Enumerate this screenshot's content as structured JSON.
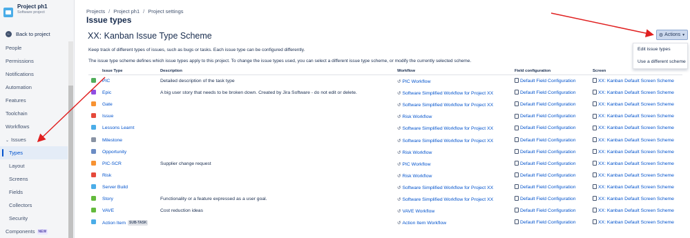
{
  "sidebar": {
    "project_name": "Project ph1",
    "project_type": "Software project",
    "back_label": "Back to project",
    "items": [
      {
        "label": "People"
      },
      {
        "label": "Permissions"
      },
      {
        "label": "Notifications"
      },
      {
        "label": "Automation"
      },
      {
        "label": "Features"
      },
      {
        "label": "Toolchain"
      },
      {
        "label": "Workflows"
      },
      {
        "label": "Issues"
      },
      {
        "label": "Types"
      },
      {
        "label": "Layout"
      },
      {
        "label": "Screens"
      },
      {
        "label": "Fields"
      },
      {
        "label": "Collectors"
      },
      {
        "label": "Security"
      },
      {
        "label": "Components",
        "badge": "NEW"
      }
    ]
  },
  "breadcrumb": [
    "Projects",
    "Project ph1",
    "Project settings"
  ],
  "page_title": "Issue types",
  "scheme_title": "XX: Kanban Issue Type Scheme",
  "description_1": "Keep track of different types of issues, such as bugs or tasks. Each issue type can be configured differently.",
  "description_2": "The issue type scheme defines which issue types apply to this project. To change the issue types used, you can select a different issue type scheme, or modify the currently selected scheme.",
  "actions": {
    "label": "Actions",
    "menu": [
      "Edit issue types",
      "Use a different scheme"
    ]
  },
  "table": {
    "headers": [
      "Issue Type",
      "Description",
      "Workflow",
      "Field configuration",
      "Screen"
    ],
    "rows": [
      {
        "name": "PIC",
        "icon_color": "#4fad5b",
        "description": "Detailed description of the task type",
        "workflow": "PIC Workflow",
        "field_config": "Default Field Configuration",
        "screen": "XX: Kanban Default Screen Scheme"
      },
      {
        "name": "Epic",
        "icon_color": "#904ee2",
        "description": "A big user story that needs to be broken down. Created by Jira Software - do not edit or delete.",
        "workflow": "Software Simplified Workflow for Project XX",
        "field_config": "Default Field Configuration",
        "screen": "XX: Kanban Default Screen Scheme"
      },
      {
        "name": "Gate",
        "icon_color": "#f79232",
        "description": "",
        "workflow": "Software Simplified Workflow for Project XX",
        "field_config": "Default Field Configuration",
        "screen": "XX: Kanban Default Screen Scheme"
      },
      {
        "name": "Issue",
        "icon_color": "#e5493a",
        "description": "",
        "workflow": "Risk Workflow",
        "field_config": "Default Field Configuration",
        "screen": "XX: Kanban Default Screen Scheme"
      },
      {
        "name": "Lessons Learnt",
        "icon_color": "#4bade8",
        "description": "",
        "workflow": "Software Simplified Workflow for Project XX",
        "field_config": "Default Field Configuration",
        "screen": "XX: Kanban Default Screen Scheme"
      },
      {
        "name": "Milestone",
        "icon_color": "#8993a4",
        "description": "",
        "workflow": "Software Simplified Workflow for Project XX",
        "field_config": "Default Field Configuration",
        "screen": "XX: Kanban Default Screen Scheme"
      },
      {
        "name": "Opportunity",
        "icon_color": "#6b8cc4",
        "description": "",
        "workflow": "Risk Workflow",
        "field_config": "Default Field Configuration",
        "screen": "XX: Kanban Default Screen Scheme"
      },
      {
        "name": "PIC-SCR",
        "icon_color": "#f79232",
        "description": "Supplier change request",
        "workflow": "PIC Workflow",
        "field_config": "Default Field Configuration",
        "screen": "XX: Kanban Default Screen Scheme"
      },
      {
        "name": "Risk",
        "icon_color": "#e5493a",
        "description": "",
        "workflow": "Risk Workflow",
        "field_config": "Default Field Configuration",
        "screen": "XX: Kanban Default Screen Scheme"
      },
      {
        "name": "Server Build",
        "icon_color": "#4bade8",
        "description": "",
        "workflow": "Software Simplified Workflow for Project XX",
        "field_config": "Default Field Configuration",
        "screen": "XX: Kanban Default Screen Scheme"
      },
      {
        "name": "Story",
        "icon_color": "#63ba3c",
        "description": "Functionality or a feature expressed as a user goal.",
        "workflow": "Software Simplified Workflow for Project XX",
        "field_config": "Default Field Configuration",
        "screen": "XX: Kanban Default Screen Scheme"
      },
      {
        "name": "VAVE",
        "icon_color": "#63ba3c",
        "description": "Cost reduction ideas",
        "workflow": "VAVE Workflow",
        "field_config": "Default Field Configuration",
        "screen": "XX: Kanban Default Screen Scheme"
      },
      {
        "name": "Action Item",
        "badge": "SUB-TASK",
        "icon_color": "#4bade8",
        "description": "",
        "workflow": "Action Item Workflow",
        "field_config": "Default Field Configuration",
        "screen": "XX: Kanban Default Screen Scheme"
      }
    ]
  },
  "colors": {
    "link": "#0052cc",
    "sidebar_bg": "#f4f5f7",
    "active_bg": "#e4ecf7",
    "annotation_arrow": "#e02020"
  }
}
